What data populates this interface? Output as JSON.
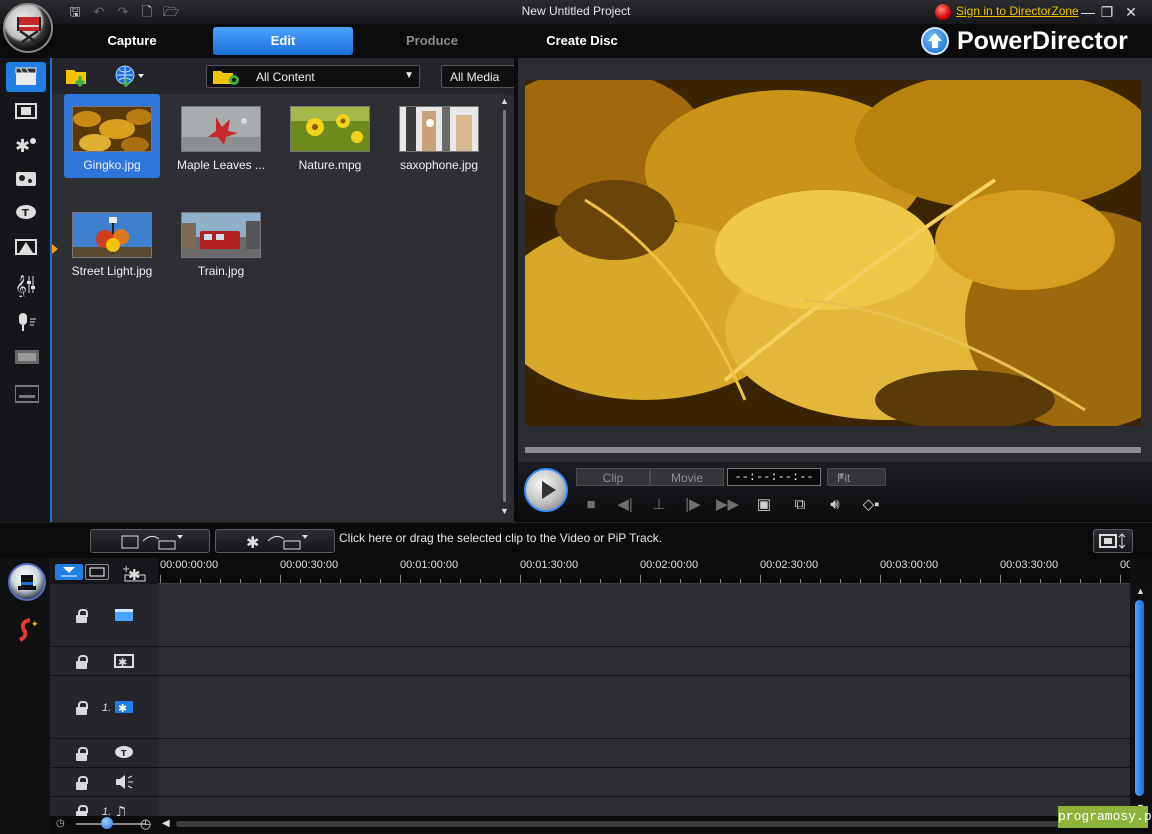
{
  "window": {
    "title": "New Untitled Project",
    "signin_link": "Sign in to DirectorZone",
    "minimize_glyph": "—",
    "maximize_glyph": "❐",
    "close_glyph": "✕"
  },
  "quick_access": [
    {
      "name": "save-icon",
      "glyph": "🖫"
    },
    {
      "name": "undo-icon",
      "glyph": "↶"
    },
    {
      "name": "redo-icon",
      "glyph": "↷"
    },
    {
      "name": "new-file-icon",
      "glyph": "🗋"
    },
    {
      "name": "open-folder-icon",
      "glyph": "🗁"
    }
  ],
  "nav": {
    "tabs": [
      {
        "label": "Capture",
        "state": "normal"
      },
      {
        "label": "Edit",
        "state": "active"
      },
      {
        "label": "Produce",
        "state": "disabled"
      },
      {
        "label": "Create Disc",
        "state": "normal"
      }
    ],
    "brand": "PowerDirector"
  },
  "rooms": [
    {
      "name": "media-room-icon",
      "active": true
    },
    {
      "name": "effect-room-icon",
      "active": false
    },
    {
      "name": "pip-objects-room-icon",
      "active": false
    },
    {
      "name": "particle-room-icon",
      "active": false
    },
    {
      "name": "title-room-icon",
      "active": false
    },
    {
      "name": "transition-room-icon",
      "active": false
    },
    {
      "name": "audio-mixing-room-icon",
      "active": false
    },
    {
      "name": "voice-over-room-icon",
      "active": false
    },
    {
      "name": "chapter-room-icon",
      "active": false
    },
    {
      "name": "subtitle-room-icon",
      "active": false
    }
  ],
  "library": {
    "content_filter": "All Content",
    "media_filter": "All Media",
    "items": [
      {
        "name": "Gingko.jpg",
        "selected": true,
        "theme": "gingko"
      },
      {
        "name": "Maple Leaves ...",
        "selected": false,
        "theme": "maple"
      },
      {
        "name": "Nature.mpg",
        "selected": false,
        "theme": "nature"
      },
      {
        "name": "saxophone.jpg",
        "selected": false,
        "theme": "sax"
      },
      {
        "name": "Street Light.jpg",
        "selected": false,
        "theme": "street"
      },
      {
        "name": "Train.jpg",
        "selected": false,
        "theme": "train"
      }
    ]
  },
  "player": {
    "mode_clip": "Clip",
    "mode_movie": "Movie",
    "timecode": "--:--:--:--",
    "fit": "Fit"
  },
  "timeline": {
    "hint": "Click here or drag the selected clip to the Video or PiP Track.",
    "ruler": [
      "00:00:00:00",
      "00:00:30:00",
      "00:01:00:00",
      "00:01:30:00",
      "00:02:00:00",
      "00:02:30:00",
      "00:03:00:00",
      "00:03:30:00",
      "00"
    ],
    "tracks": [
      {
        "num": "",
        "icon": "video-track-icon"
      },
      {
        "num": "",
        "icon": "effect-track-icon"
      },
      {
        "num": "1.",
        "icon": "pip-track-icon"
      },
      {
        "num": "",
        "icon": "title-track-icon"
      },
      {
        "num": "",
        "icon": "voice-track-icon"
      },
      {
        "num": "1.",
        "icon": "music-track-icon"
      }
    ]
  },
  "watermark": "programosy.pl",
  "colors": {
    "accent": "#1f7fe4",
    "signin": "#f2c400",
    "panel": "#2b2d33"
  }
}
